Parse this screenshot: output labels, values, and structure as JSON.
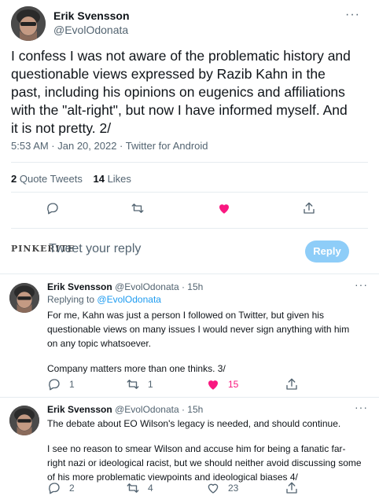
{
  "main": {
    "author_name": "Erik Svensson",
    "author_handle": "@EvolOdonata",
    "text": "I confess I was not aware of the problematic history and questionable views expressed by Razib Kahn in the past, including his opinions on eugenics and affiliations with the \"alt-right\", but now I have informed myself. And it is not pretty. 2/",
    "meta": "5:53 AM · Jan 20, 2022 · Twitter for Android",
    "quote_count": "2",
    "quote_label": "Quote Tweets",
    "like_count": "14",
    "like_label": "Likes",
    "more": "···"
  },
  "compose": {
    "badge": "PINKERITE",
    "placeholder": "Tweet your reply",
    "button": "Reply"
  },
  "replies": [
    {
      "author_name": "Erik Svensson",
      "author_handle": "@EvolOdonata",
      "time": "· 15h",
      "replying_prefix": "Replying to",
      "replying_handle": "@EvolOdonata",
      "paragraphs": [
        "For me, Kahn was just a person I followed on Twitter, but given his questionable views on many issues I would never sign anything with him on any topic whatsoever.",
        "Company matters more than one thinks. 3/"
      ],
      "reply_count": "1",
      "retweet_count": "1",
      "like_count": "15",
      "more": "···"
    },
    {
      "author_name": "Erik Svensson",
      "author_handle": "@EvolOdonata",
      "time": "· 15h",
      "paragraphs": [
        "The debate about EO Wilson's legacy is needed, and should continue.",
        "I see no reason to smear Wilson and accuse him for being a fanatic far-right nazi or ideological racist, but we should neither avoid discussing some of his more problematic viewpoints and ideological biases 4/"
      ],
      "reply_count": "2",
      "retweet_count": "4",
      "like_count": "23",
      "more": "···"
    }
  ],
  "colors": {
    "accent": "#1d9bf0",
    "like_active": "#f91880",
    "muted": "#536471",
    "reply_button": "#8ecdf8"
  }
}
